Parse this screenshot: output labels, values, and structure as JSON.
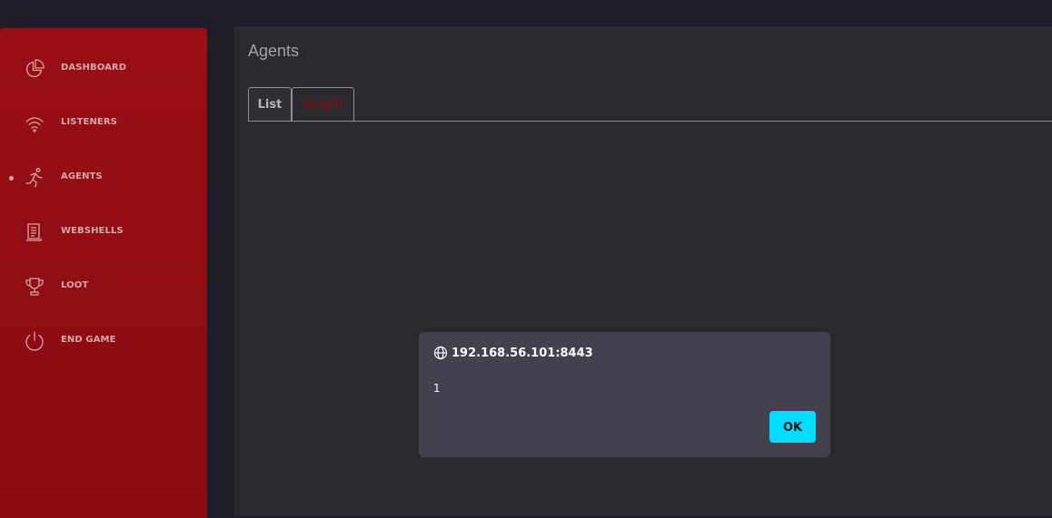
{
  "sidebar": {
    "items": [
      {
        "label": "DASHBOARD",
        "icon": "pie-chart-icon",
        "active": false
      },
      {
        "label": "LISTENERS",
        "icon": "wifi-icon",
        "active": false
      },
      {
        "label": "AGENTS",
        "icon": "running-person-icon",
        "active": true
      },
      {
        "label": "WEBSHELLS",
        "icon": "document-icon",
        "active": false
      },
      {
        "label": "LOOT",
        "icon": "trophy-icon",
        "active": false
      },
      {
        "label": "END GAME",
        "icon": "power-icon",
        "active": false
      }
    ]
  },
  "main": {
    "title": "Agents",
    "tabs": [
      {
        "label": "List",
        "active": true
      },
      {
        "label": "Graph",
        "active": false
      }
    ]
  },
  "dialog": {
    "origin": "192.168.56.101:8443",
    "message": "1",
    "ok_label": "OK"
  },
  "colors": {
    "sidebar_bg": "#980f15",
    "main_bg": "#2a2a2e",
    "page_bg": "#1e1e29",
    "dialog_bg": "#42414d",
    "ok_button": "#00ddff"
  }
}
